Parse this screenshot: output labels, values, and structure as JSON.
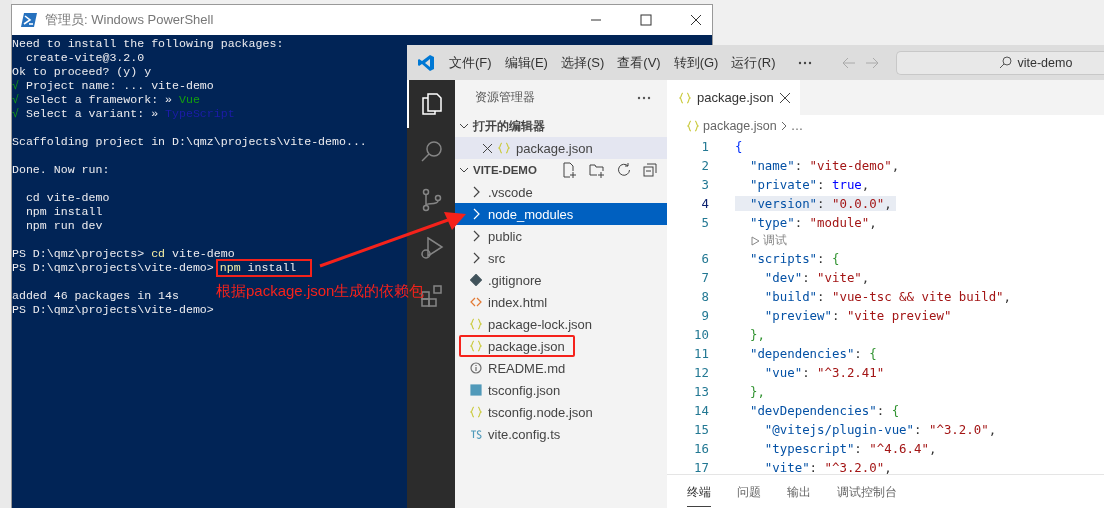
{
  "powershell": {
    "title": "管理员: Windows PowerShell",
    "lines": [
      {
        "kind": "text",
        "segments": [
          {
            "text": "Need to install the following packages:",
            "kind": "plain"
          }
        ]
      },
      {
        "kind": "text",
        "segments": [
          {
            "text": "  create-vite@3.2.0",
            "kind": "plain"
          }
        ]
      },
      {
        "kind": "text",
        "segments": [
          {
            "text": "Ok to proceed? (y) y",
            "kind": "plain"
          }
        ]
      },
      {
        "kind": "text",
        "segments": [
          {
            "text": "√",
            "kind": "ok"
          },
          {
            "text": " Project name: ... vite-demo",
            "kind": "plain"
          }
        ]
      },
      {
        "kind": "text",
        "segments": [
          {
            "text": "√",
            "kind": "ok"
          },
          {
            "text": " Select a framework: » ",
            "kind": "plain"
          },
          {
            "text": "Vue",
            "kind": "green"
          }
        ]
      },
      {
        "kind": "text",
        "segments": [
          {
            "text": "√",
            "kind": "ok"
          },
          {
            "text": " Select a variant: » ",
            "kind": "plain"
          },
          {
            "text": "TypeScript",
            "kind": "blue"
          }
        ]
      },
      {
        "kind": "blank"
      },
      {
        "kind": "text",
        "segments": [
          {
            "text": "Scaffolding project in D:\\qmz\\projects\\vite-demo...",
            "kind": "plain"
          }
        ]
      },
      {
        "kind": "blank"
      },
      {
        "kind": "text",
        "segments": [
          {
            "text": "Done. Now run:",
            "kind": "plain"
          }
        ]
      },
      {
        "kind": "blank"
      },
      {
        "kind": "text",
        "segments": [
          {
            "text": "  cd vite-demo",
            "kind": "plain"
          }
        ]
      },
      {
        "kind": "text",
        "segments": [
          {
            "text": "  npm install",
            "kind": "plain"
          }
        ]
      },
      {
        "kind": "text",
        "segments": [
          {
            "text": "  npm run dev",
            "kind": "plain"
          }
        ]
      },
      {
        "kind": "blank"
      },
      {
        "kind": "text",
        "segments": [
          {
            "text": "PS D:\\qmz\\projects> ",
            "kind": "plain"
          },
          {
            "text": "cd",
            "kind": "cmd"
          },
          {
            "text": " vite-demo",
            "kind": "plain"
          }
        ]
      },
      {
        "kind": "text",
        "segments": [
          {
            "text": "PS D:\\qmz\\projects\\vite-demo>",
            "kind": "plain"
          },
          {
            "text": "npm",
            "kind": "cmd",
            "boxed": true
          },
          {
            "text": " install",
            "kind": "plain",
            "boxed": true
          }
        ]
      },
      {
        "kind": "blank"
      },
      {
        "kind": "text",
        "segments": [
          {
            "text": "added 46 packages in 14s",
            "kind": "plain"
          }
        ]
      },
      {
        "kind": "text",
        "segments": [
          {
            "text": "PS D:\\qmz\\projects\\vite-demo>",
            "kind": "plain"
          }
        ]
      }
    ]
  },
  "vscode": {
    "menu": [
      "文件(F)",
      "编辑(E)",
      "选择(S)",
      "查看(V)",
      "转到(G)",
      "运行(R)"
    ],
    "search": "vite-demo",
    "activity_bar": [
      {
        "kind": "explorer",
        "selected": true
      },
      {
        "kind": "search",
        "selected": false
      },
      {
        "kind": "source-control",
        "selected": false
      },
      {
        "kind": "run-debug",
        "selected": false
      },
      {
        "kind": "extensions",
        "selected": false
      }
    ],
    "explorer": {
      "title": "资源管理器",
      "open_editors": {
        "label": "打开的编辑器",
        "expanded": true,
        "items": [
          {
            "name": "package.json",
            "kind": "json"
          }
        ]
      },
      "project": {
        "label": "VITE-DEMO",
        "expanded": true,
        "items": [
          {
            "name": ".vscode",
            "kind": "folder",
            "selected": false
          },
          {
            "name": "node_modules",
            "kind": "folder",
            "selected": true
          },
          {
            "name": "public",
            "kind": "folder",
            "selected": false
          },
          {
            "name": "src",
            "kind": "folder",
            "selected": false
          },
          {
            "name": ".gitignore",
            "kind": "git",
            "selected": false
          },
          {
            "name": "index.html",
            "kind": "html",
            "selected": false
          },
          {
            "name": "package-lock.json",
            "kind": "json",
            "selected": false
          },
          {
            "name": "package.json",
            "kind": "json",
            "selected": false,
            "annotated": true
          },
          {
            "name": "README.md",
            "kind": "info",
            "selected": false
          },
          {
            "name": "tsconfig.json",
            "kind": "ts-box",
            "selected": false
          },
          {
            "name": "tsconfig.node.json",
            "kind": "json",
            "selected": false
          },
          {
            "name": "vite.config.ts",
            "kind": "ts",
            "selected": false
          }
        ]
      }
    },
    "tab": {
      "name": "package.json",
      "selected": true
    },
    "breadcrumb": [
      "package.json",
      "…"
    ],
    "code": [
      {
        "kind": "line",
        "number": "1",
        "current": false,
        "segments": [
          {
            "text": "{",
            "kind": "brace1"
          }
        ]
      },
      {
        "kind": "line",
        "number": "2",
        "current": false,
        "segments": [
          {
            "text": "  \"name\"",
            "kind": "key"
          },
          {
            "text": ": ",
            "kind": "punct"
          },
          {
            "text": "\"vite-demo\"",
            "kind": "str"
          },
          {
            "text": ",",
            "kind": "punct"
          }
        ]
      },
      {
        "kind": "line",
        "number": "3",
        "current": false,
        "segments": [
          {
            "text": "  \"private\"",
            "kind": "key"
          },
          {
            "text": ": ",
            "kind": "punct"
          },
          {
            "text": "true",
            "kind": "bool"
          },
          {
            "text": ",",
            "kind": "punct"
          }
        ]
      },
      {
        "kind": "line",
        "number": "4",
        "current": true,
        "segments": [
          {
            "text": "  \"version\"",
            "kind": "key"
          },
          {
            "text": ": ",
            "kind": "punct"
          },
          {
            "text": "\"0.0.0\"",
            "kind": "str"
          },
          {
            "text": ",",
            "kind": "punct"
          }
        ]
      },
      {
        "kind": "line",
        "number": "5",
        "current": false,
        "segments": [
          {
            "text": "  \"type\"",
            "kind": "key"
          },
          {
            "text": ": ",
            "kind": "punct"
          },
          {
            "text": "\"module\"",
            "kind": "str"
          },
          {
            "text": ",",
            "kind": "punct"
          }
        ]
      },
      {
        "kind": "codelens",
        "text": "调试"
      },
      {
        "kind": "line",
        "number": "6",
        "current": false,
        "segments": [
          {
            "text": "  \"scripts\"",
            "kind": "key"
          },
          {
            "text": ": ",
            "kind": "punct"
          },
          {
            "text": "{",
            "kind": "brace2"
          }
        ]
      },
      {
        "kind": "line",
        "number": "7",
        "current": false,
        "segments": [
          {
            "text": "    \"dev\"",
            "kind": "key"
          },
          {
            "text": ": ",
            "kind": "punct"
          },
          {
            "text": "\"vite\"",
            "kind": "str"
          },
          {
            "text": ",",
            "kind": "punct"
          }
        ]
      },
      {
        "kind": "line",
        "number": "8",
        "current": false,
        "segments": [
          {
            "text": "    \"build\"",
            "kind": "key"
          },
          {
            "text": ": ",
            "kind": "punct"
          },
          {
            "text": "\"vue-tsc && vite build\"",
            "kind": "str"
          },
          {
            "text": ",",
            "kind": "punct"
          }
        ]
      },
      {
        "kind": "line",
        "number": "9",
        "current": false,
        "segments": [
          {
            "text": "    \"preview\"",
            "kind": "key"
          },
          {
            "text": ": ",
            "kind": "punct"
          },
          {
            "text": "\"vite preview\"",
            "kind": "str"
          }
        ]
      },
      {
        "kind": "line",
        "number": "10",
        "current": false,
        "segments": [
          {
            "text": "  },",
            "kind": "brace2"
          }
        ]
      },
      {
        "kind": "line",
        "number": "11",
        "current": false,
        "segments": [
          {
            "text": "  \"dependencies\"",
            "kind": "key"
          },
          {
            "text": ": ",
            "kind": "punct"
          },
          {
            "text": "{",
            "kind": "brace2"
          }
        ]
      },
      {
        "kind": "line",
        "number": "12",
        "current": false,
        "segments": [
          {
            "text": "    \"vue\"",
            "kind": "key"
          },
          {
            "text": ": ",
            "kind": "punct"
          },
          {
            "text": "\"^3.2.41\"",
            "kind": "str"
          }
        ]
      },
      {
        "kind": "line",
        "number": "13",
        "current": false,
        "segments": [
          {
            "text": "  },",
            "kind": "brace2"
          }
        ]
      },
      {
        "kind": "line",
        "number": "14",
        "current": false,
        "segments": [
          {
            "text": "  \"devDependencies\"",
            "kind": "key"
          },
          {
            "text": ": ",
            "kind": "punct"
          },
          {
            "text": "{",
            "kind": "brace2"
          }
        ]
      },
      {
        "kind": "line",
        "number": "15",
        "current": false,
        "segments": [
          {
            "text": "    \"@vitejs/plugin-vue\"",
            "kind": "key"
          },
          {
            "text": ": ",
            "kind": "punct"
          },
          {
            "text": "\"^3.2.0\"",
            "kind": "str"
          },
          {
            "text": ",",
            "kind": "punct"
          }
        ]
      },
      {
        "kind": "line",
        "number": "16",
        "current": false,
        "segments": [
          {
            "text": "    \"typescript\"",
            "kind": "key"
          },
          {
            "text": ": ",
            "kind": "punct"
          },
          {
            "text": "\"^4.6.4\"",
            "kind": "str"
          },
          {
            "text": ",",
            "kind": "punct"
          }
        ]
      },
      {
        "kind": "line",
        "number": "17",
        "current": false,
        "segments": [
          {
            "text": "    \"vite\"",
            "kind": "key"
          },
          {
            "text": ": ",
            "kind": "punct"
          },
          {
            "text": "\"^3.2.0\"",
            "kind": "str"
          },
          {
            "text": ",",
            "kind": "punct"
          }
        ]
      }
    ],
    "panel_tabs": [
      {
        "label": "终端",
        "selected": true
      },
      {
        "label": "问题",
        "selected": false
      },
      {
        "label": "输出",
        "selected": false
      },
      {
        "label": "调试控制台",
        "selected": false
      }
    ]
  },
  "annotation": {
    "label": "根据package.json生成的依赖包"
  }
}
